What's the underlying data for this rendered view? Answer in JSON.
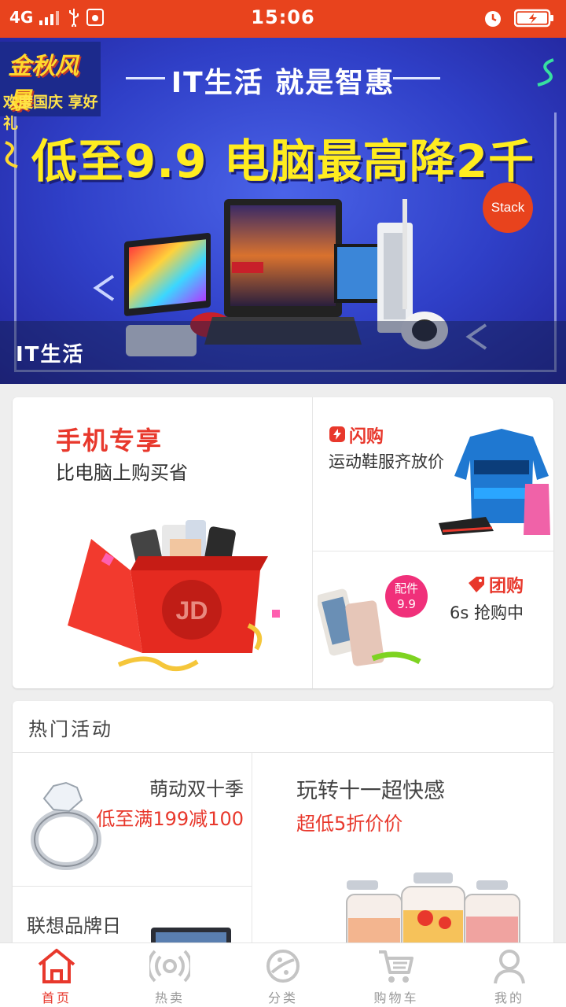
{
  "status_bar": {
    "network": "4G",
    "time": "15:06"
  },
  "banner": {
    "promo_title": "金秋风暴",
    "promo_sub": "欢度国庆 享好礼",
    "slogan": "IT生活 就是智惠",
    "headline": "低至9.9 电脑最高降2千",
    "stack_badge": "Stack",
    "caption": "IT生活"
  },
  "promo_grid": {
    "phone": {
      "title": "手机专享",
      "subtitle": "比电脑上购买省",
      "logo": "JD"
    },
    "flash": {
      "title": "闪购",
      "subtitle": "运动鞋服齐放价"
    },
    "group": {
      "title": "团购",
      "subtitle": "6s 抢购中",
      "badge_top": "配件",
      "badge_bottom": "9.9"
    }
  },
  "hot_activities": {
    "header": "热门活动",
    "items": [
      {
        "title": "萌动双十季",
        "subtitle": "低至满199减100"
      },
      {
        "title": "玩转十一超快感",
        "subtitle": "超低5折价价"
      },
      {
        "title": "联想品牌日",
        "subtitle": ""
      }
    ]
  },
  "tabbar": {
    "items": [
      {
        "label": "首页",
        "icon": "home-icon",
        "active": true
      },
      {
        "label": "热卖",
        "icon": "broadcast-icon",
        "active": false
      },
      {
        "label": "分类",
        "icon": "planet-icon",
        "active": false
      },
      {
        "label": "购物车",
        "icon": "cart-icon",
        "active": false
      },
      {
        "label": "我的",
        "icon": "user-icon",
        "active": false
      }
    ]
  },
  "colors": {
    "accent": "#e8431d",
    "red_text": "#e8382c",
    "banner_blue": "#2f3fc7",
    "headline_yellow": "#ffec1f"
  }
}
